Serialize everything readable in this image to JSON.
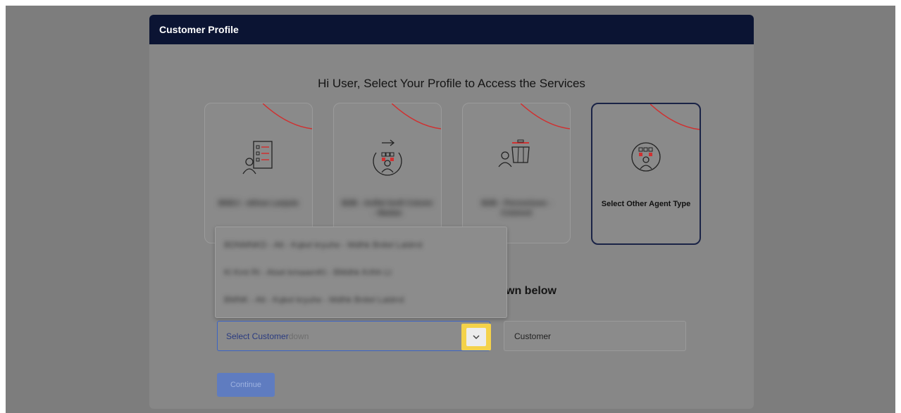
{
  "modal": {
    "title": "Customer Profile",
    "heading": "Hi User, Select Your Profile to Access the Services",
    "subheading": "wn below"
  },
  "cards": [
    {
      "label": "BNDJ - ekhoe Lanjute",
      "icon": "checklist-person-icon",
      "selected": false
    },
    {
      "label": "B2B - Aoflet bvdl Cstomr - Madan",
      "icon": "transfer-person-icon",
      "selected": false
    },
    {
      "label": "B2B - Pernoniune - Cistmnd",
      "icon": "counter-person-icon",
      "selected": false
    },
    {
      "label": "Select Other Agent Type",
      "icon": "agent-group-icon",
      "selected": true
    }
  ],
  "dropdown": {
    "options": [
      "BDNMNKD - Alt - Kqkel kryuhe - Mdlhk Bnitel Laldrrd",
      "Kl Kmt Rt - Alset kmaaenKt - BMdhk Krlhh Lt",
      "BMNK - Alt - Kqkel kryuhe - Mdlhk Bnitel Laldrrd"
    ]
  },
  "select": {
    "placeholder": "Select Customer",
    "ghost_text": "down"
  },
  "customer_field": {
    "value": "Customer"
  },
  "continue_label": "Continue",
  "colors": {
    "header": "#0b1433",
    "accent_red": "#d03030",
    "highlight": "#f4d24a",
    "primary_button": "#5f7cc0"
  }
}
